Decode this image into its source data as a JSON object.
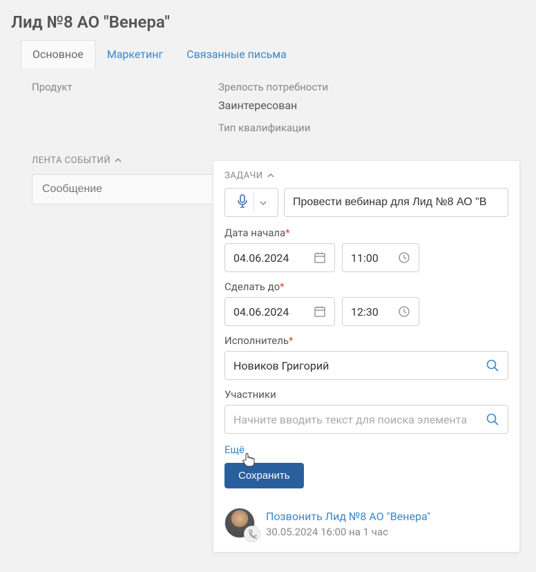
{
  "header": {
    "title": "Лид №8 АО \"Венера\""
  },
  "tabs": [
    {
      "label": "Основное",
      "active": true
    },
    {
      "label": "Маркетинг",
      "active": false
    },
    {
      "label": "Связанные письма",
      "active": false
    }
  ],
  "fields": {
    "product_label": "Продукт",
    "maturity_label": "Зрелость потребности",
    "maturity_value": "Заинтересован",
    "qualification_label": "Тип квалификации"
  },
  "feed": {
    "header": "ЛЕНТА СОБЫТИЙ",
    "message_placeholder": "Сообщение"
  },
  "tasks_panel": {
    "header": "ЗАДАЧИ",
    "title_value": "Провести вебинар для Лид №8 АО \"В",
    "start_label": "Дата начала",
    "start_date": "04.06.2024",
    "start_time": "11:00",
    "due_label": "Сделать до",
    "due_date": "04.06.2024",
    "due_time": "12:30",
    "assignee_label": "Исполнитель",
    "assignee_value": "Новиков Григорий",
    "participants_label": "Участники",
    "participants_placeholder": "Начните вводить текст для поиска элемента",
    "more_label": "Ещё",
    "save_label": "Сохранить",
    "existing_task": {
      "title": "Позвонить Лид №8 АО \"Венера\"",
      "meta": "30.05.2024 16:00 на 1 час"
    }
  }
}
